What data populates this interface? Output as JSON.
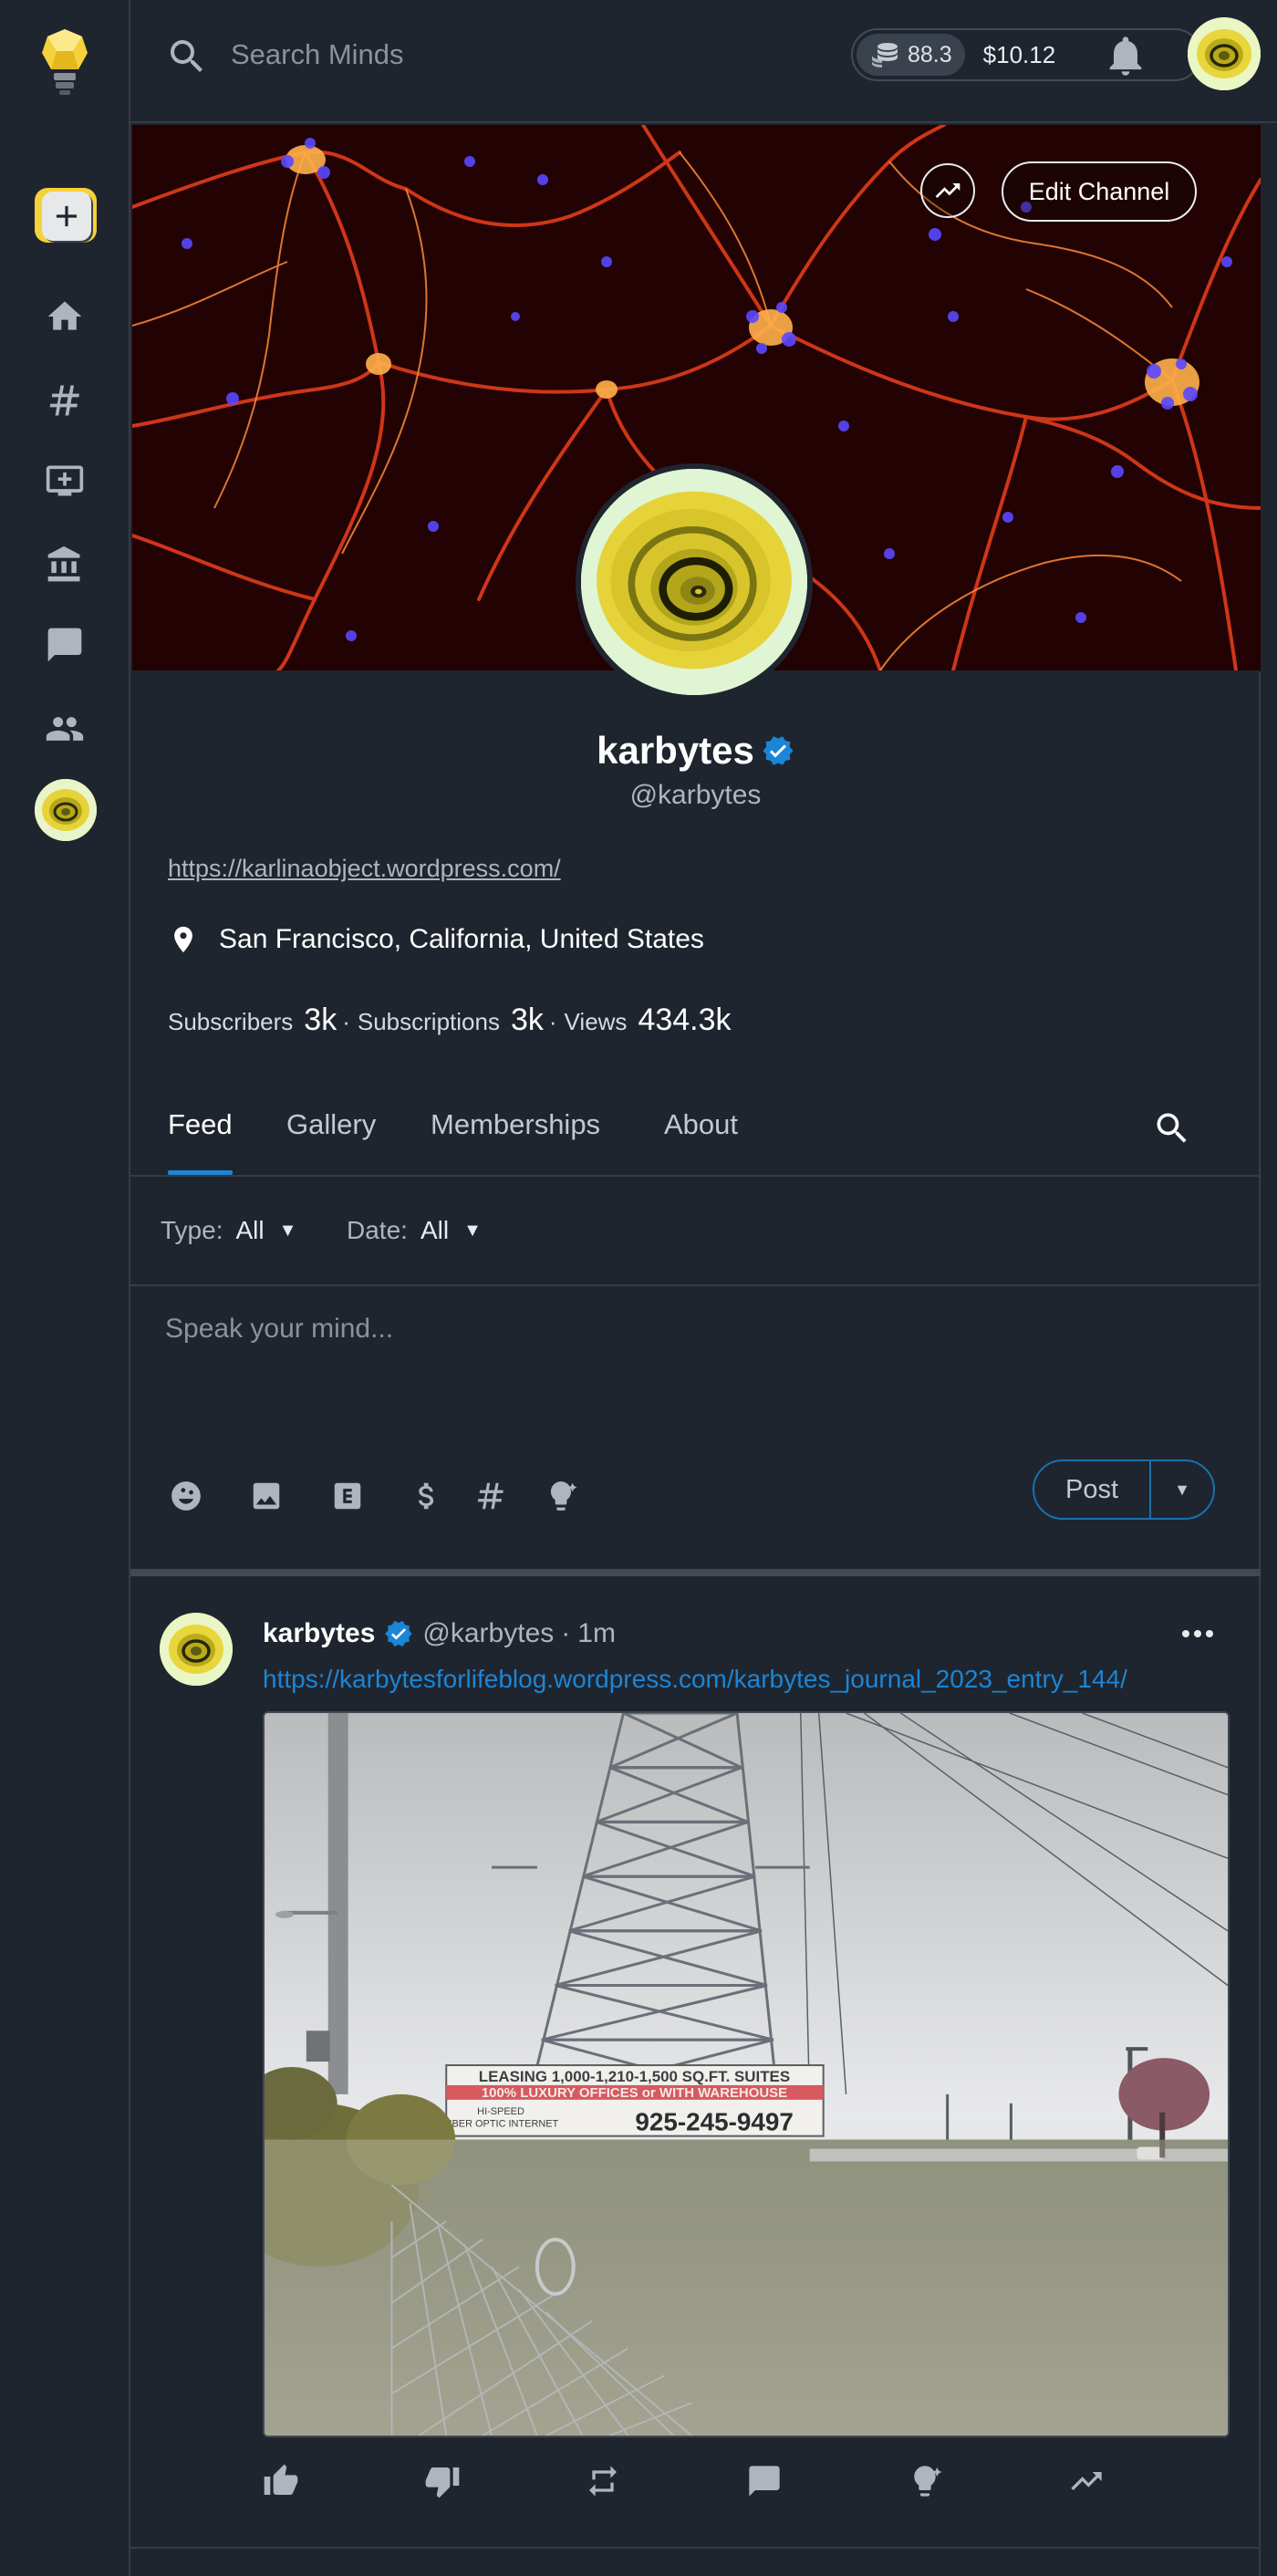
{
  "topbar": {
    "search_placeholder": "Search Minds",
    "wallet_tokens": "88.3",
    "wallet_usd": "$10.12"
  },
  "sidebar": {
    "items": [
      {
        "name": "newsfeed",
        "icon": "home-icon"
      },
      {
        "name": "discovery",
        "icon": "hashtag-icon"
      },
      {
        "name": "boost-console",
        "icon": "monitor-add-icon"
      },
      {
        "name": "wallet",
        "icon": "bank-icon"
      },
      {
        "name": "messenger",
        "icon": "chat-icon"
      },
      {
        "name": "groups",
        "icon": "group-icon"
      }
    ]
  },
  "banner": {
    "edit_label": "Edit Channel"
  },
  "profile": {
    "name": "karbytes",
    "username": "@karbytes",
    "website": "https://karlinaobject.wordpress.com/",
    "location": "San Francisco, California, United States",
    "stats": {
      "subscribers_label": "Subscribers",
      "subscribers": "3k",
      "subscriptions_label": "Subscriptions",
      "subscriptions": "3k",
      "views_label": "Views",
      "views": "434.3k"
    }
  },
  "tabs": [
    {
      "label": "Feed",
      "active": true
    },
    {
      "label": "Gallery",
      "active": false
    },
    {
      "label": "Memberships",
      "active": false
    },
    {
      "label": "About",
      "active": false
    }
  ],
  "filters": {
    "type_label": "Type:",
    "type_value": "All",
    "date_label": "Date:",
    "date_value": "All"
  },
  "composer": {
    "placeholder": "Speak your mind...",
    "post_label": "Post",
    "tools": [
      "emoji-icon",
      "image-icon",
      "blog-icon",
      "dollar-icon",
      "hashtag-icon",
      "boost-icon"
    ]
  },
  "post": {
    "name": "karbytes",
    "handle": "@karbytes",
    "separator": "·",
    "time": "1m",
    "link": "https://karbytesforlifeblog.wordpress.com/karbytes_journal_2023_entry_144/",
    "sign": {
      "line1": "LEASING 1,000-1,210-1,500 SQ.FT. SUITES",
      "line2": "100% LUXURY OFFICES or WITH WAREHOUSE",
      "line3": "HI-SPEED",
      "line4": "FIBER OPTIC INTERNET",
      "phone": "925-245-9497"
    },
    "actions": [
      "thumbs-up-icon",
      "thumbs-down-icon",
      "remind-icon",
      "comment-icon",
      "boost-icon",
      "trending-icon"
    ]
  },
  "colors": {
    "background": "#1f252e",
    "accent": "#1b85d6",
    "brand_yellow": "#f5d13b"
  }
}
